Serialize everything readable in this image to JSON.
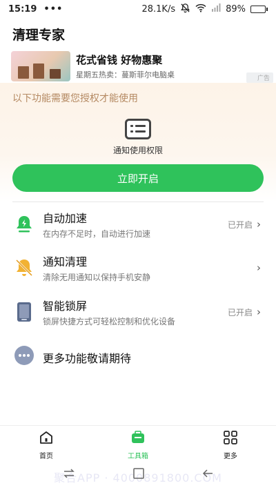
{
  "status_bar": {
    "time": "15:19",
    "dots": "•••",
    "network_speed": "28.1K/s",
    "battery": "89%",
    "battery_level": 0.89,
    "icons": [
      "mute-bell-icon",
      "wifi-icon",
      "signal-icon",
      "battery-icon"
    ]
  },
  "header": {
    "title": "清理专家"
  },
  "ad": {
    "title": "花式省钱 好物惠聚",
    "subtitle": "星期五热卖：蔓斯菲尔电脑桌",
    "tag": "广告"
  },
  "permission": {
    "hint": "以下功能需要您授权才能使用",
    "icon": "notification-list-icon",
    "label": "通知使用权限",
    "button_label": "立即开启"
  },
  "features": [
    {
      "name": "自动加速",
      "desc": "在内存不足时，自动进行加速",
      "status": "已开启",
      "icon": "rocket-bell-icon"
    },
    {
      "name": "通知清理",
      "desc": "清除无用通知以保持手机安静",
      "status": "",
      "icon": "mute-bell-icon"
    },
    {
      "name": "智能锁屏",
      "desc": "锁屏快捷方式可轻松控制和优化设备",
      "status": "已开启",
      "icon": "phone-lock-icon"
    },
    {
      "name": "更多功能敬请期待",
      "desc": "",
      "status": "",
      "icon": "more-dots-icon"
    }
  ],
  "tabbar": {
    "items": [
      {
        "label": "首页",
        "icon": "home-icon",
        "active": false
      },
      {
        "label": "工具箱",
        "icon": "toolbox-icon",
        "active": true
      },
      {
        "label": "更多",
        "icon": "grid-icon",
        "active": false
      }
    ]
  },
  "system_nav": {
    "watermark": "聚合APP · 4000891800.COM",
    "icons": [
      "swap-icon",
      "home-square-icon",
      "back-arrow-icon"
    ]
  },
  "colors": {
    "accent": "#2fc25b",
    "hint_text": "#b58a63",
    "icon_lock": "#5a6b8c",
    "icon_bell_warn": "#f2b233",
    "icon_more": "#8e9bb8"
  }
}
